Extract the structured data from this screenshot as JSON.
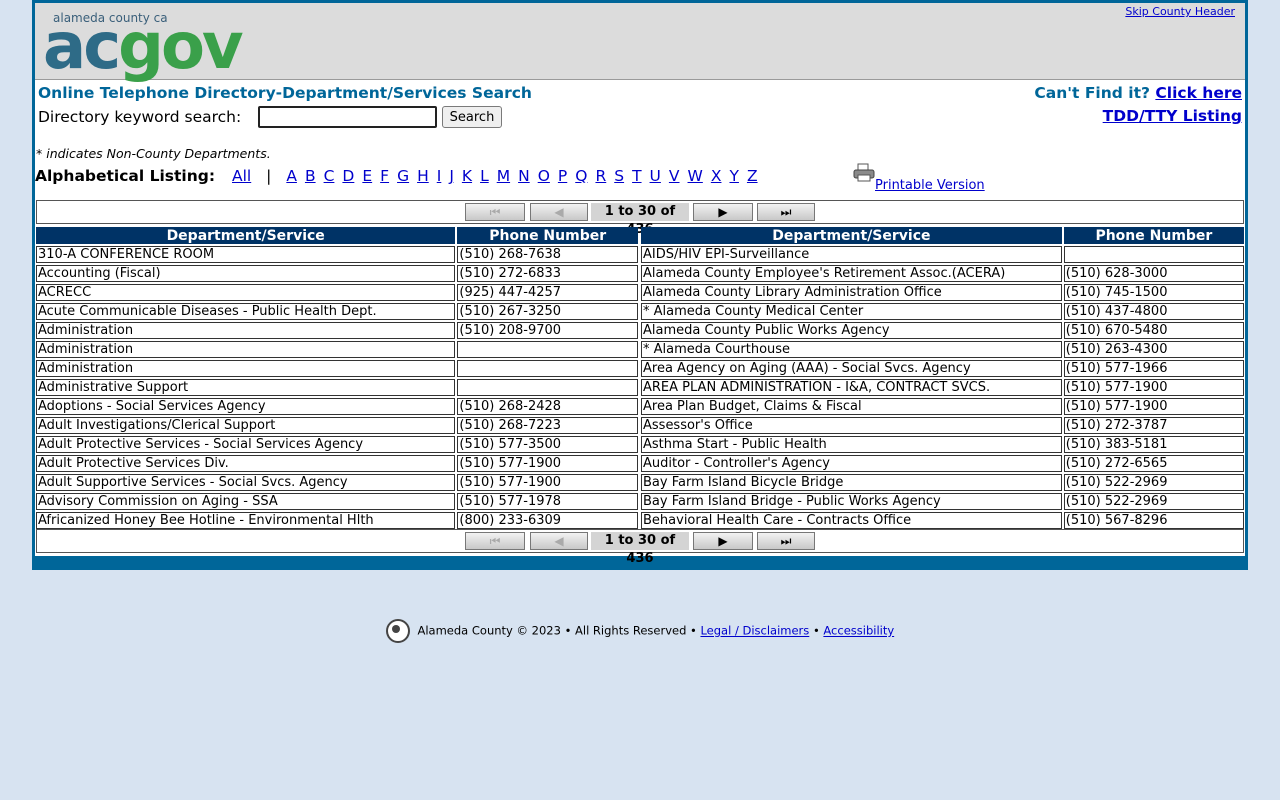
{
  "header": {
    "logo_small": "alameda county ca",
    "logo_ac": "ac",
    "logo_gov": "gov",
    "skip_link": "Skip County Header"
  },
  "title": "Online Telephone Directory-Department/Services Search",
  "cant_find_text": "Can't Find it?",
  "cant_find_link": "Click here",
  "tdd_link": "TDD/TTY Listing",
  "search": {
    "label": "Directory keyword search:",
    "value": "",
    "button": "Search"
  },
  "note": "* indicates Non-County Departments.",
  "alpha": {
    "label": "Alphabetical Listing:",
    "all": "All",
    "sep": "|",
    "letters": [
      "A",
      "B",
      "C",
      "D",
      "E",
      "F",
      "G",
      "H",
      "I",
      "J",
      "K",
      "L",
      "M",
      "N",
      "O",
      "P",
      "Q",
      "R",
      "S",
      "T",
      "U",
      "V",
      "W",
      "X",
      "Y",
      "Z"
    ]
  },
  "printable": "Printable Version",
  "pager": {
    "count": "1 to 30 of 436"
  },
  "columns": {
    "dept": "Department/Service",
    "phone": "Phone Number"
  },
  "left_rows": [
    {
      "name": "310-A CONFERENCE ROOM",
      "phone": "(510) 268-7638"
    },
    {
      "name": "Accounting (Fiscal)",
      "phone": "(510) 272-6833"
    },
    {
      "name": "ACRECC",
      "phone": "(925) 447-4257"
    },
    {
      "name": "Acute Communicable Diseases - Public Health Dept.",
      "phone": "(510) 267-3250"
    },
    {
      "name": "Administration",
      "phone": "(510) 208-9700"
    },
    {
      "name": "Administration",
      "phone": ""
    },
    {
      "name": "Administration",
      "phone": ""
    },
    {
      "name": "Administrative Support",
      "phone": ""
    },
    {
      "name": "Adoptions - Social Services Agency",
      "phone": "(510) 268-2428"
    },
    {
      "name": "Adult Investigations/Clerical Support",
      "phone": "(510) 268-7223"
    },
    {
      "name": "Adult Protective Services - Social Services Agency",
      "phone": "(510) 577-3500"
    },
    {
      "name": "Adult Protective Services Div.",
      "phone": "(510) 577-1900"
    },
    {
      "name": "Adult Supportive Services - Social Svcs. Agency",
      "phone": "(510) 577-1900"
    },
    {
      "name": "Advisory Commission on Aging - SSA",
      "phone": "(510) 577-1978"
    },
    {
      "name": "Africanized Honey Bee Hotline - Environmental Hlth",
      "phone": "(800) 233-6309"
    }
  ],
  "right_rows": [
    {
      "name": "AIDS/HIV EPI-Surveillance",
      "phone": ""
    },
    {
      "name": "Alameda County Employee's Retirement Assoc.(ACERA)",
      "phone": "(510) 628-3000"
    },
    {
      "name": "Alameda County Library Administration Office",
      "phone": "(510) 745-1500"
    },
    {
      "name": "* Alameda County Medical Center",
      "phone": "(510) 437-4800"
    },
    {
      "name": "Alameda County Public Works Agency",
      "phone": "(510) 670-5480"
    },
    {
      "name": "* Alameda Courthouse",
      "phone": "(510) 263-4300"
    },
    {
      "name": "Area Agency on Aging (AAA) - Social Svcs. Agency",
      "phone": "(510) 577-1966"
    },
    {
      "name": "AREA PLAN ADMINISTRATION - I&A, CONTRACT SVCS.",
      "phone": "(510) 577-1900"
    },
    {
      "name": "Area Plan Budget, Claims & Fiscal",
      "phone": "(510) 577-1900"
    },
    {
      "name": "Assessor's Office",
      "phone": "(510) 272-3787"
    },
    {
      "name": "Asthma Start - Public Health",
      "phone": "(510) 383-5181"
    },
    {
      "name": "Auditor - Controller's Agency",
      "phone": "(510) 272-6565"
    },
    {
      "name": "Bay Farm Island Bicycle Bridge",
      "phone": "(510) 522-2969"
    },
    {
      "name": "Bay Farm Island Bridge - Public Works Agency",
      "phone": "(510) 522-2969"
    },
    {
      "name": "Behavioral Health Care - Contracts Office",
      "phone": "(510) 567-8296"
    }
  ],
  "footer": {
    "text": "Alameda County © 2023 • All Rights Reserved •",
    "legal": "Legal / Disclaimers",
    "bullet": "•",
    "accessibility": "Accessibility"
  }
}
